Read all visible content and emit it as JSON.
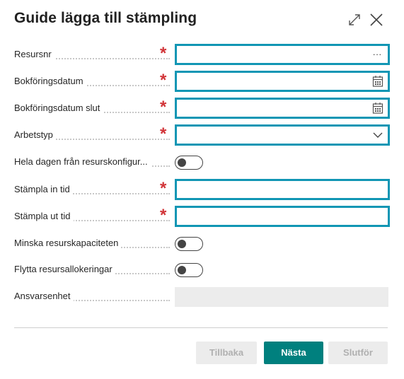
{
  "dialog": {
    "title": "Guide lägga till stämpling",
    "expand_icon": "expand-diagonal-icon",
    "close_icon": "close-x-icon"
  },
  "fields": [
    {
      "label": "Resursnr",
      "required": true,
      "type": "lookup",
      "value": "",
      "icon": "ellipsis-icon",
      "icon_text": "···"
    },
    {
      "label": "Bokföringsdatum",
      "required": true,
      "type": "date",
      "value": "",
      "icon": "calendar-icon"
    },
    {
      "label": "Bokföringsdatum slut",
      "required": true,
      "type": "date",
      "value": "",
      "icon": "calendar-icon"
    },
    {
      "label": "Arbetstyp",
      "required": true,
      "type": "select",
      "value": "",
      "icon": "chevron-down-icon"
    },
    {
      "label": "Hela dagen från resurskonfigur...",
      "required": false,
      "type": "toggle",
      "value": false
    },
    {
      "label": "Stämpla in tid",
      "required": true,
      "type": "text",
      "value": ""
    },
    {
      "label": "Stämpla ut tid",
      "required": true,
      "type": "text",
      "value": ""
    },
    {
      "label": "Minska resurskapaciteten",
      "required": false,
      "type": "toggle",
      "value": false
    },
    {
      "label": "Flytta resursallokeringar",
      "required": false,
      "type": "toggle",
      "value": false
    },
    {
      "label": "Ansvarsenhet",
      "required": false,
      "type": "readonly",
      "value": ""
    }
  ],
  "required_marker": "*",
  "buttons": {
    "back": "Tillbaka",
    "next": "Nästa",
    "finish": "Slutför"
  },
  "colors": {
    "focus_border": "#1196b4",
    "required": "#d13438",
    "primary_button": "#00807e",
    "disabled_bg": "#ececec"
  }
}
